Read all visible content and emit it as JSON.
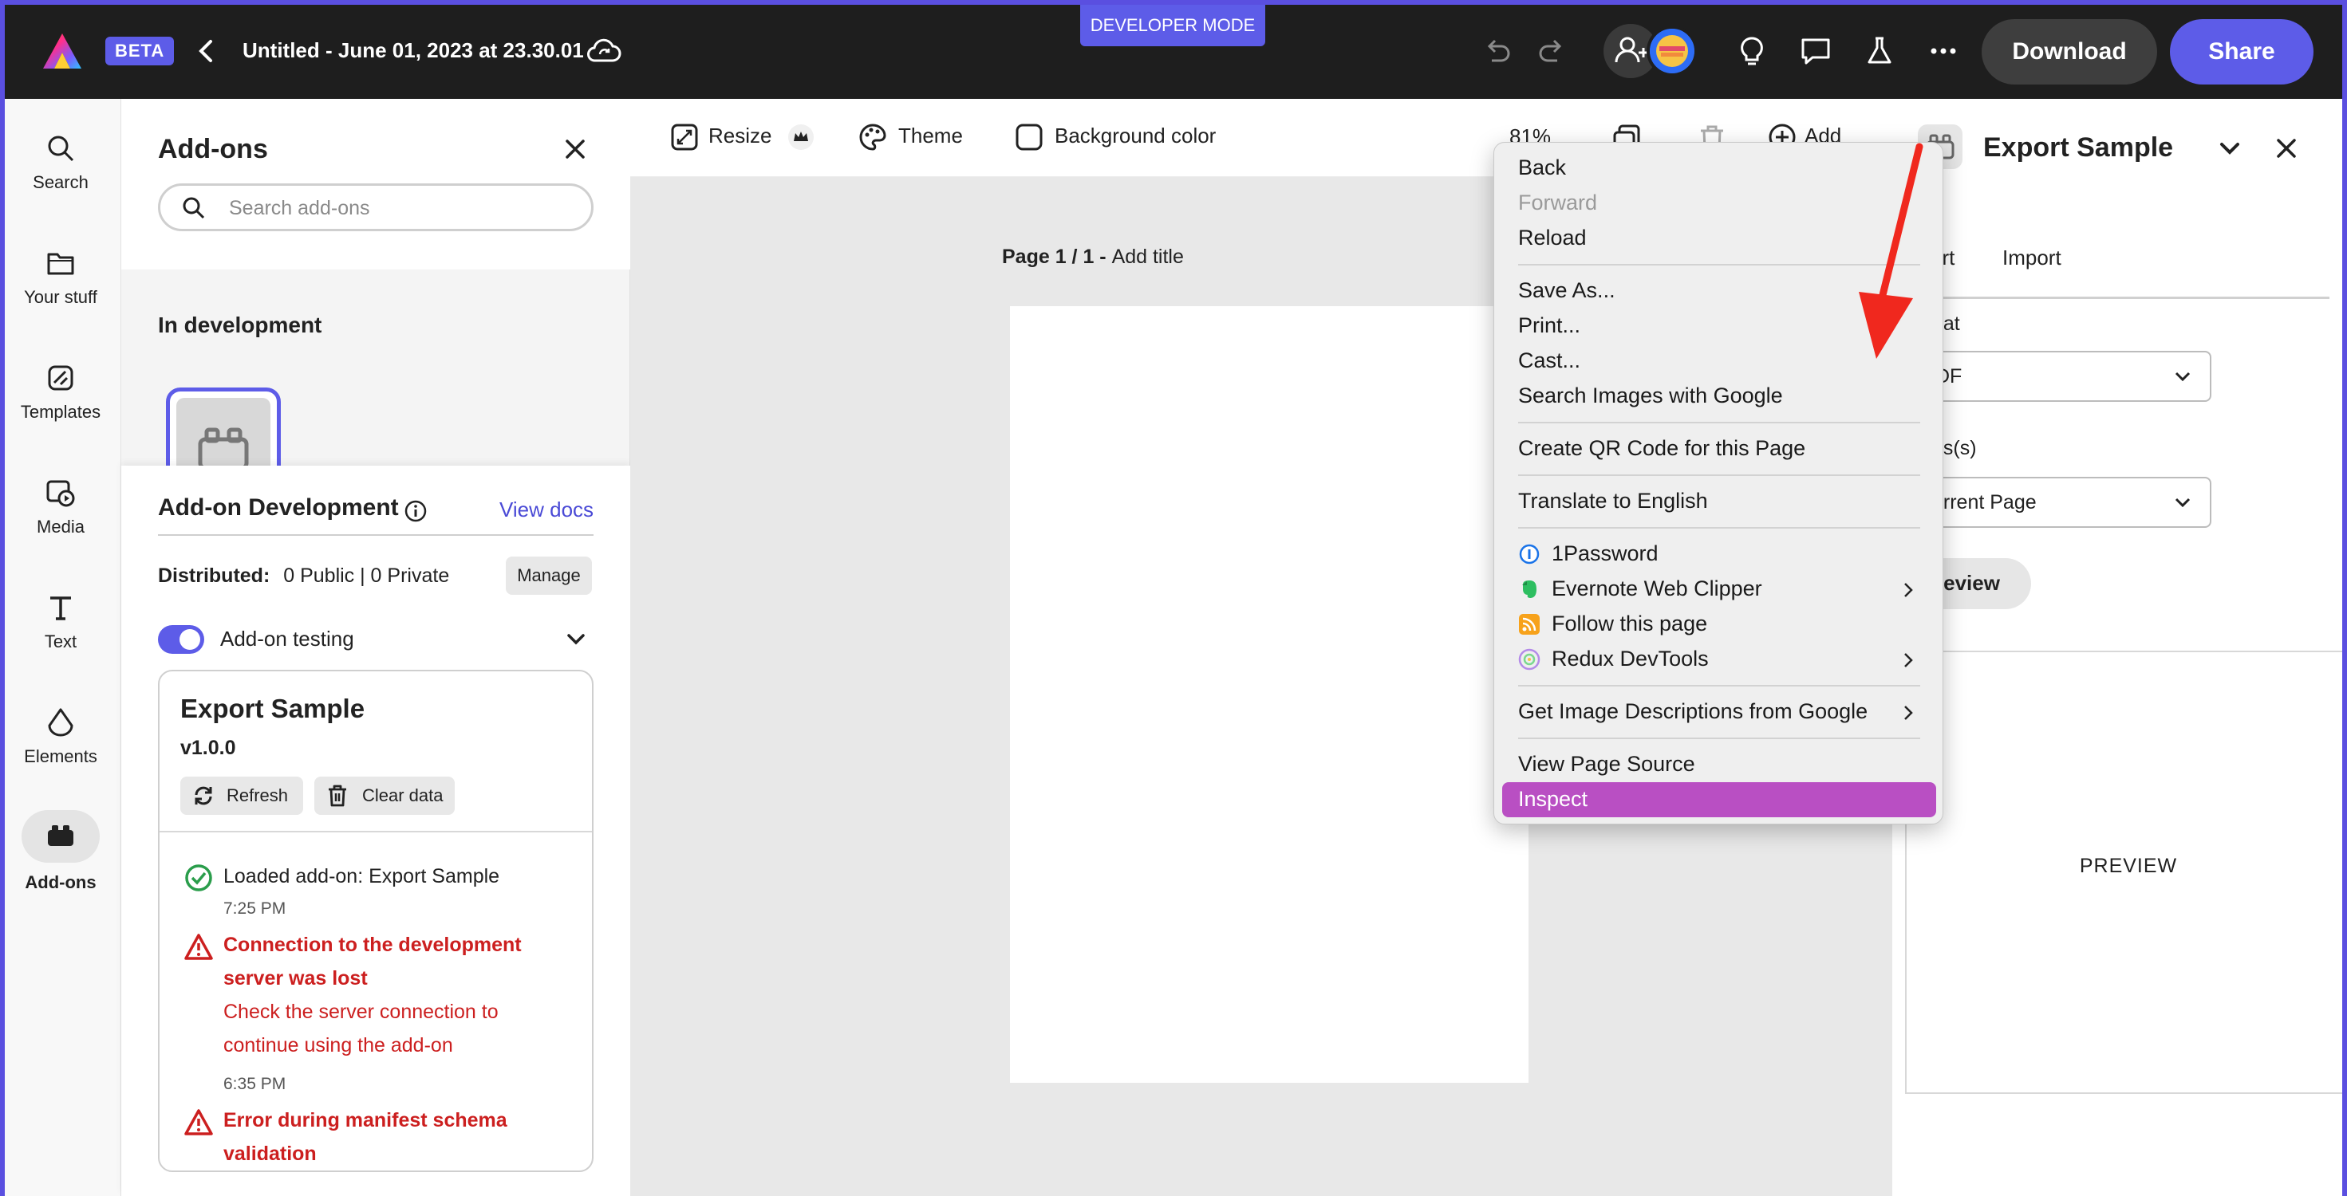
{
  "header": {
    "beta_label": "BETA",
    "document_title": "Untitled - June 01, 2023 at 23.30.01",
    "developer_mode": "DEVELOPER MODE",
    "download_label": "Download",
    "share_label": "Share"
  },
  "rail": {
    "items": [
      {
        "label": "Search",
        "icon": "search-icon"
      },
      {
        "label": "Your stuff",
        "icon": "folder-icon"
      },
      {
        "label": "Templates",
        "icon": "templates-icon"
      },
      {
        "label": "Media",
        "icon": "media-icon"
      },
      {
        "label": "Text",
        "icon": "text-icon"
      },
      {
        "label": "Elements",
        "icon": "elements-icon"
      },
      {
        "label": "Add-ons",
        "icon": "addons-icon",
        "active": true
      }
    ]
  },
  "addons_panel": {
    "title": "Add-ons",
    "search_placeholder": "Search add-ons",
    "in_development": "In development",
    "dev": {
      "title": "Add-on Development",
      "view_docs": "View docs",
      "distributed_label": "Distributed:",
      "distributed_value": "0 Public | 0 Private",
      "manage_label": "Manage",
      "testing_label": "Add-on testing",
      "testing_enabled": true
    },
    "card": {
      "name": "Export Sample",
      "version": "v1.0.0",
      "refresh_label": "Refresh",
      "clear_label": "Clear data",
      "logs": [
        {
          "type": "success",
          "lines": [
            "Loaded add-on: Export Sample"
          ],
          "time": "7:25 PM"
        },
        {
          "type": "error",
          "title_lines": [
            "Connection to the development",
            "server was lost"
          ],
          "lines": [
            "Check the server connection to",
            "continue using the add-on"
          ],
          "time": "6:35 PM"
        },
        {
          "type": "error",
          "title_lines": [
            "Error during manifest schema",
            "validation"
          ],
          "lines": [],
          "time": ""
        }
      ]
    }
  },
  "toolbar": {
    "resize_label": "Resize",
    "theme_label": "Theme",
    "background_label": "Background color",
    "zoom": "81%",
    "add_label": "Add"
  },
  "canvas": {
    "page_prefix": "Page 1 / 1 - ",
    "page_title_placeholder": "Add title"
  },
  "right_panel": {
    "title": "Export Sample",
    "tab_export_partial": "ort",
    "tab_import": "Import",
    "format_label_partial": "nat",
    "format_value_partial": "DF",
    "pages_label_partial": "es(s)",
    "pages_value_partial": "urrent Page",
    "preview_button_partial": "review",
    "preview_text": "PREVIEW"
  },
  "context_menu": {
    "items": [
      {
        "label": "Back"
      },
      {
        "label": "Forward",
        "disabled": true
      },
      {
        "label": "Reload"
      },
      {
        "label": "Save As..."
      },
      {
        "label": "Print..."
      },
      {
        "label": "Cast..."
      },
      {
        "label": "Search Images with Google"
      },
      {
        "label": "Create QR Code for this Page"
      },
      {
        "label": "Translate to English"
      },
      {
        "label": "1Password"
      },
      {
        "label": "Evernote Web Clipper"
      },
      {
        "label": "Follow this page"
      },
      {
        "label": "Redux DevTools"
      },
      {
        "label": "Get Image Descriptions from Google"
      },
      {
        "label": "View Page Source"
      },
      {
        "label": "Inspect",
        "highlighted": true
      }
    ]
  },
  "colors": {
    "accent": "#5d5ce8",
    "error": "#cc1f1f",
    "success": "#2a9d4b",
    "highlight": "#b94fc3",
    "annotation_arrow": "#f0281e"
  }
}
